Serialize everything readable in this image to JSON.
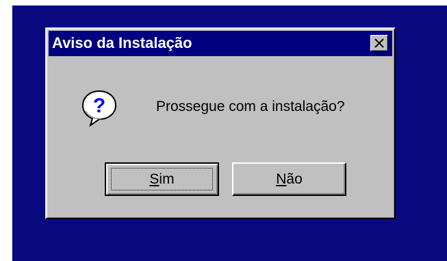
{
  "dialog": {
    "title": "Aviso da Instalação",
    "message": "Prossegue com a instalação?",
    "icon": "question-icon",
    "close_icon": "close-icon"
  },
  "buttons": {
    "yes": {
      "mnemonic": "S",
      "rest": "im"
    },
    "no": {
      "mnemonic": "N",
      "rest": "ão"
    }
  },
  "colors": {
    "desktop": "#0a0a80",
    "titlebar": "#000080",
    "dialog_face": "#c0c0c0"
  }
}
